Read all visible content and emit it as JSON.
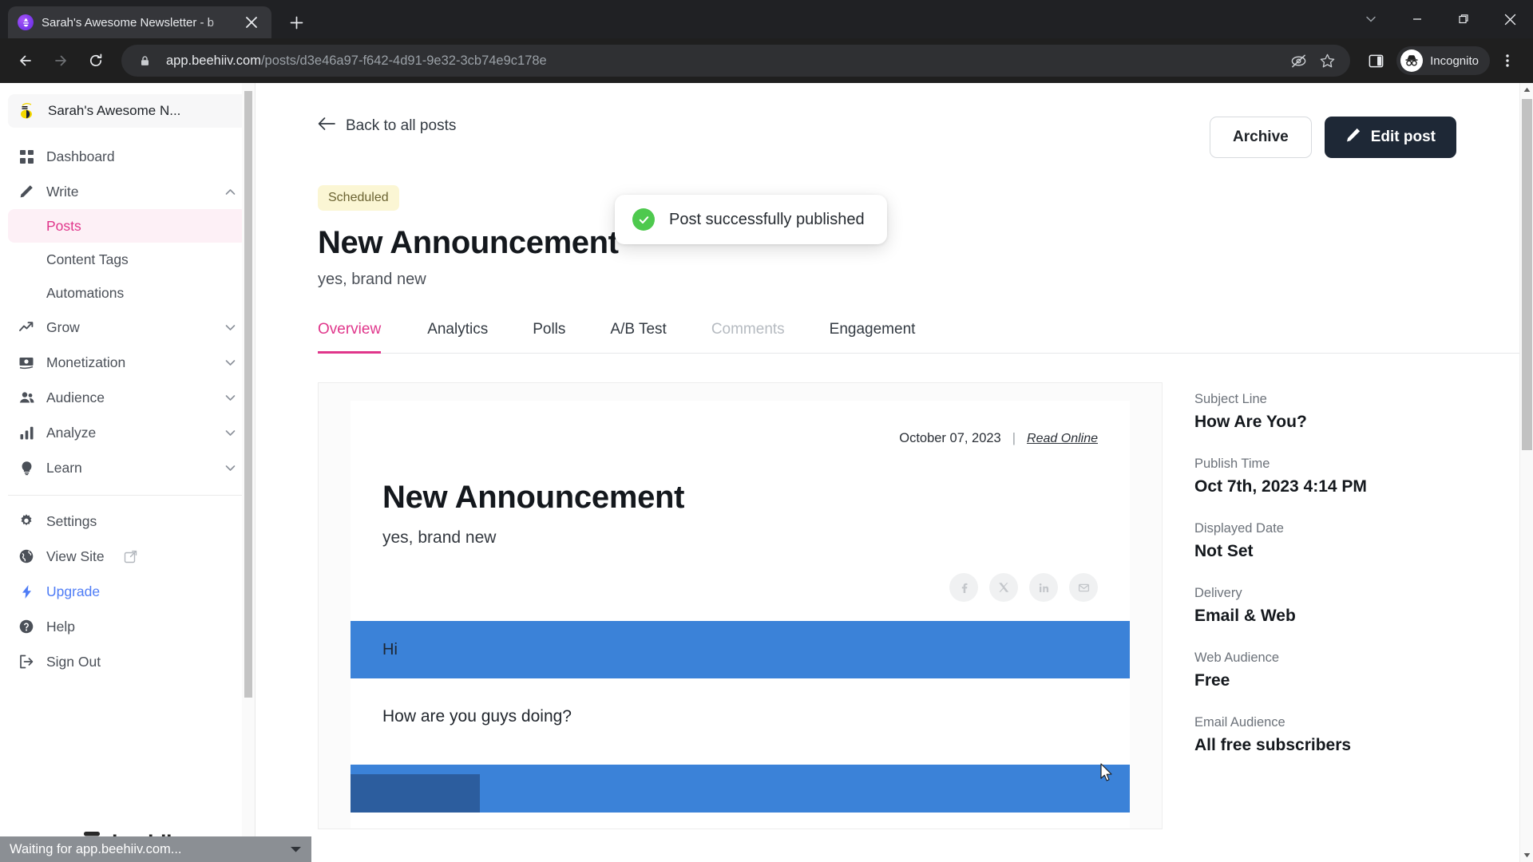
{
  "browser": {
    "tab": {
      "title": "Sarah's Awesome Newsletter - b",
      "favicon": "beehiiv-favicon-icon",
      "close": "×"
    },
    "new_tab_label": "+",
    "window_controls": [
      "chevron-down-icon",
      "minimize-icon",
      "maximize-icon",
      "close-icon"
    ],
    "url_domain": "app.beehiiv.com",
    "url_path": "/posts/d3e46a97-f642-4d91-9e32-3cb74e9c178e",
    "lock_icon": "lock-icon",
    "toolbar_icons": [
      "third-party-cookie-blocked-icon",
      "bookmark-star-icon",
      "side-panel-icon"
    ],
    "profile_label": "Incognito",
    "menu_icon": "three-dot-menu-icon"
  },
  "sidebar": {
    "workspace": {
      "name": "Sarah's Awesome N...",
      "logo": "beehiiv-bee-logo"
    },
    "items": [
      {
        "label": "Dashboard",
        "icon": "grid-icon",
        "expandable": false,
        "active": false
      },
      {
        "label": "Write",
        "icon": "pencil-icon",
        "expandable": true,
        "expanded": true,
        "chevron": "chevron-up-icon"
      },
      {
        "label": "Grow",
        "icon": "trending-up-icon",
        "expandable": true,
        "expanded": false,
        "chevron": "chevron-down-icon"
      },
      {
        "label": "Monetization",
        "icon": "money-icon",
        "expandable": true,
        "expanded": false,
        "chevron": "chevron-down-icon"
      },
      {
        "label": "Audience",
        "icon": "users-icon",
        "expandable": true,
        "expanded": false,
        "chevron": "chevron-down-icon"
      },
      {
        "label": "Analyze",
        "icon": "bar-chart-icon",
        "expandable": true,
        "expanded": false,
        "chevron": "chevron-down-icon"
      },
      {
        "label": "Learn",
        "icon": "lightbulb-icon",
        "expandable": true,
        "expanded": false,
        "chevron": "chevron-down-icon"
      }
    ],
    "write_children": [
      {
        "label": "Posts",
        "active": true
      },
      {
        "label": "Content Tags",
        "active": false
      },
      {
        "label": "Automations",
        "active": false
      }
    ],
    "bottom_items": [
      {
        "label": "Settings",
        "icon": "gear-icon",
        "external": false
      },
      {
        "label": "View Site",
        "icon": "globe-icon",
        "external": true
      },
      {
        "label": "Upgrade",
        "icon": "lightning-bolt-icon",
        "external": false,
        "highlight": true
      },
      {
        "label": "Help",
        "icon": "question-circle-icon",
        "external": false
      },
      {
        "label": "Sign Out",
        "icon": "logout-icon",
        "external": false
      }
    ],
    "accent_color": "#e0368b",
    "upgrade_color": "#4e7cf6"
  },
  "toast": {
    "message": "Post successfully published",
    "icon": "check-circle-icon",
    "color": "#4ec94e"
  },
  "header": {
    "back_label": "Back to all posts",
    "back_icon": "arrow-left-icon",
    "archive_label": "Archive",
    "edit_label": "Edit post",
    "edit_icon": "pencil-icon"
  },
  "post": {
    "status_badge": "Scheduled",
    "title": "New Announcement",
    "subtitle": "yes, brand new"
  },
  "tabs": [
    {
      "label": "Overview",
      "active": true,
      "disabled": false
    },
    {
      "label": "Analytics",
      "active": false,
      "disabled": false
    },
    {
      "label": "Polls",
      "active": false,
      "disabled": false
    },
    {
      "label": "A/B Test",
      "active": false,
      "disabled": false
    },
    {
      "label": "Comments",
      "active": false,
      "disabled": true
    },
    {
      "label": "Engagement",
      "active": false,
      "disabled": false
    }
  ],
  "preview": {
    "date": "October 07, 2023",
    "separator": "|",
    "read_online": "Read Online",
    "title": "New Announcement",
    "subtitle": "yes, brand new",
    "social_icons": [
      "facebook-icon",
      "x-twitter-icon",
      "linkedin-icon",
      "email-icon"
    ],
    "blocks": [
      {
        "type": "blue-band",
        "text": "Hi"
      },
      {
        "type": "white-band",
        "text": "How are you guys doing?"
      },
      {
        "type": "blue-band",
        "text": ""
      }
    ],
    "band_color": "#3b82d8"
  },
  "meta": [
    {
      "label": "Subject Line",
      "value": "How Are You?"
    },
    {
      "label": "Publish Time",
      "value": "Oct 7th, 2023 4:14 PM"
    },
    {
      "label": "Displayed Date",
      "value": "Not Set"
    },
    {
      "label": "Delivery",
      "value": "Email & Web"
    },
    {
      "label": "Web Audience",
      "value": "Free"
    },
    {
      "label": "Email Audience",
      "value": "All free subscribers"
    }
  ],
  "status_bar": {
    "text": "Waiting for app.beehiiv.com...",
    "caret": "caret-down-icon"
  },
  "watermark": {
    "text": "beehiiv",
    "icon": "beehiiv-logo-icon"
  }
}
